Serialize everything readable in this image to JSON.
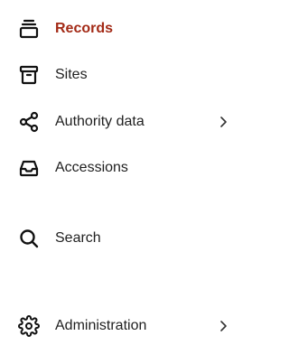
{
  "sidebar": {
    "items": [
      {
        "label": "Records",
        "icon": "records-stack-icon",
        "active": true,
        "has_submenu": false
      },
      {
        "label": "Sites",
        "icon": "archive-box-icon",
        "active": false,
        "has_submenu": false
      },
      {
        "label": "Authority data",
        "icon": "share-nodes-icon",
        "active": false,
        "has_submenu": true
      },
      {
        "label": "Accessions",
        "icon": "inbox-tray-icon",
        "active": false,
        "has_submenu": false
      },
      {
        "label": "Search",
        "icon": "search-icon",
        "active": false,
        "has_submenu": false
      },
      {
        "label": "Administration",
        "icon": "gear-icon",
        "active": false,
        "has_submenu": true
      }
    ]
  },
  "colors": {
    "active_text": "#a32a16",
    "text": "#1f1f1f",
    "icon": "#111111",
    "background": "#ffffff"
  }
}
